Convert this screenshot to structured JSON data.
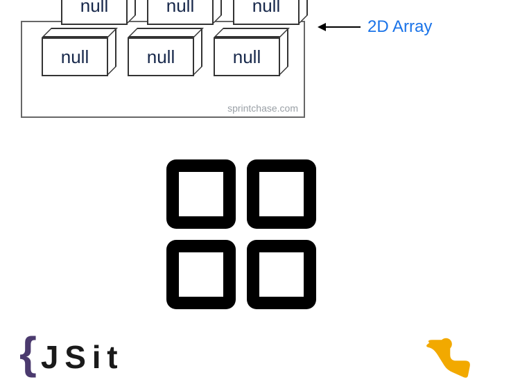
{
  "diagram": {
    "label": "2D Array",
    "cells": {
      "backRow": [
        "null",
        "null",
        "null"
      ],
      "frontRow": [
        "null",
        "null",
        "null"
      ]
    },
    "watermark": "sprintchase.com"
  },
  "bottomBrace": {
    "brace": "{",
    "partial": "J   S  i  t"
  }
}
